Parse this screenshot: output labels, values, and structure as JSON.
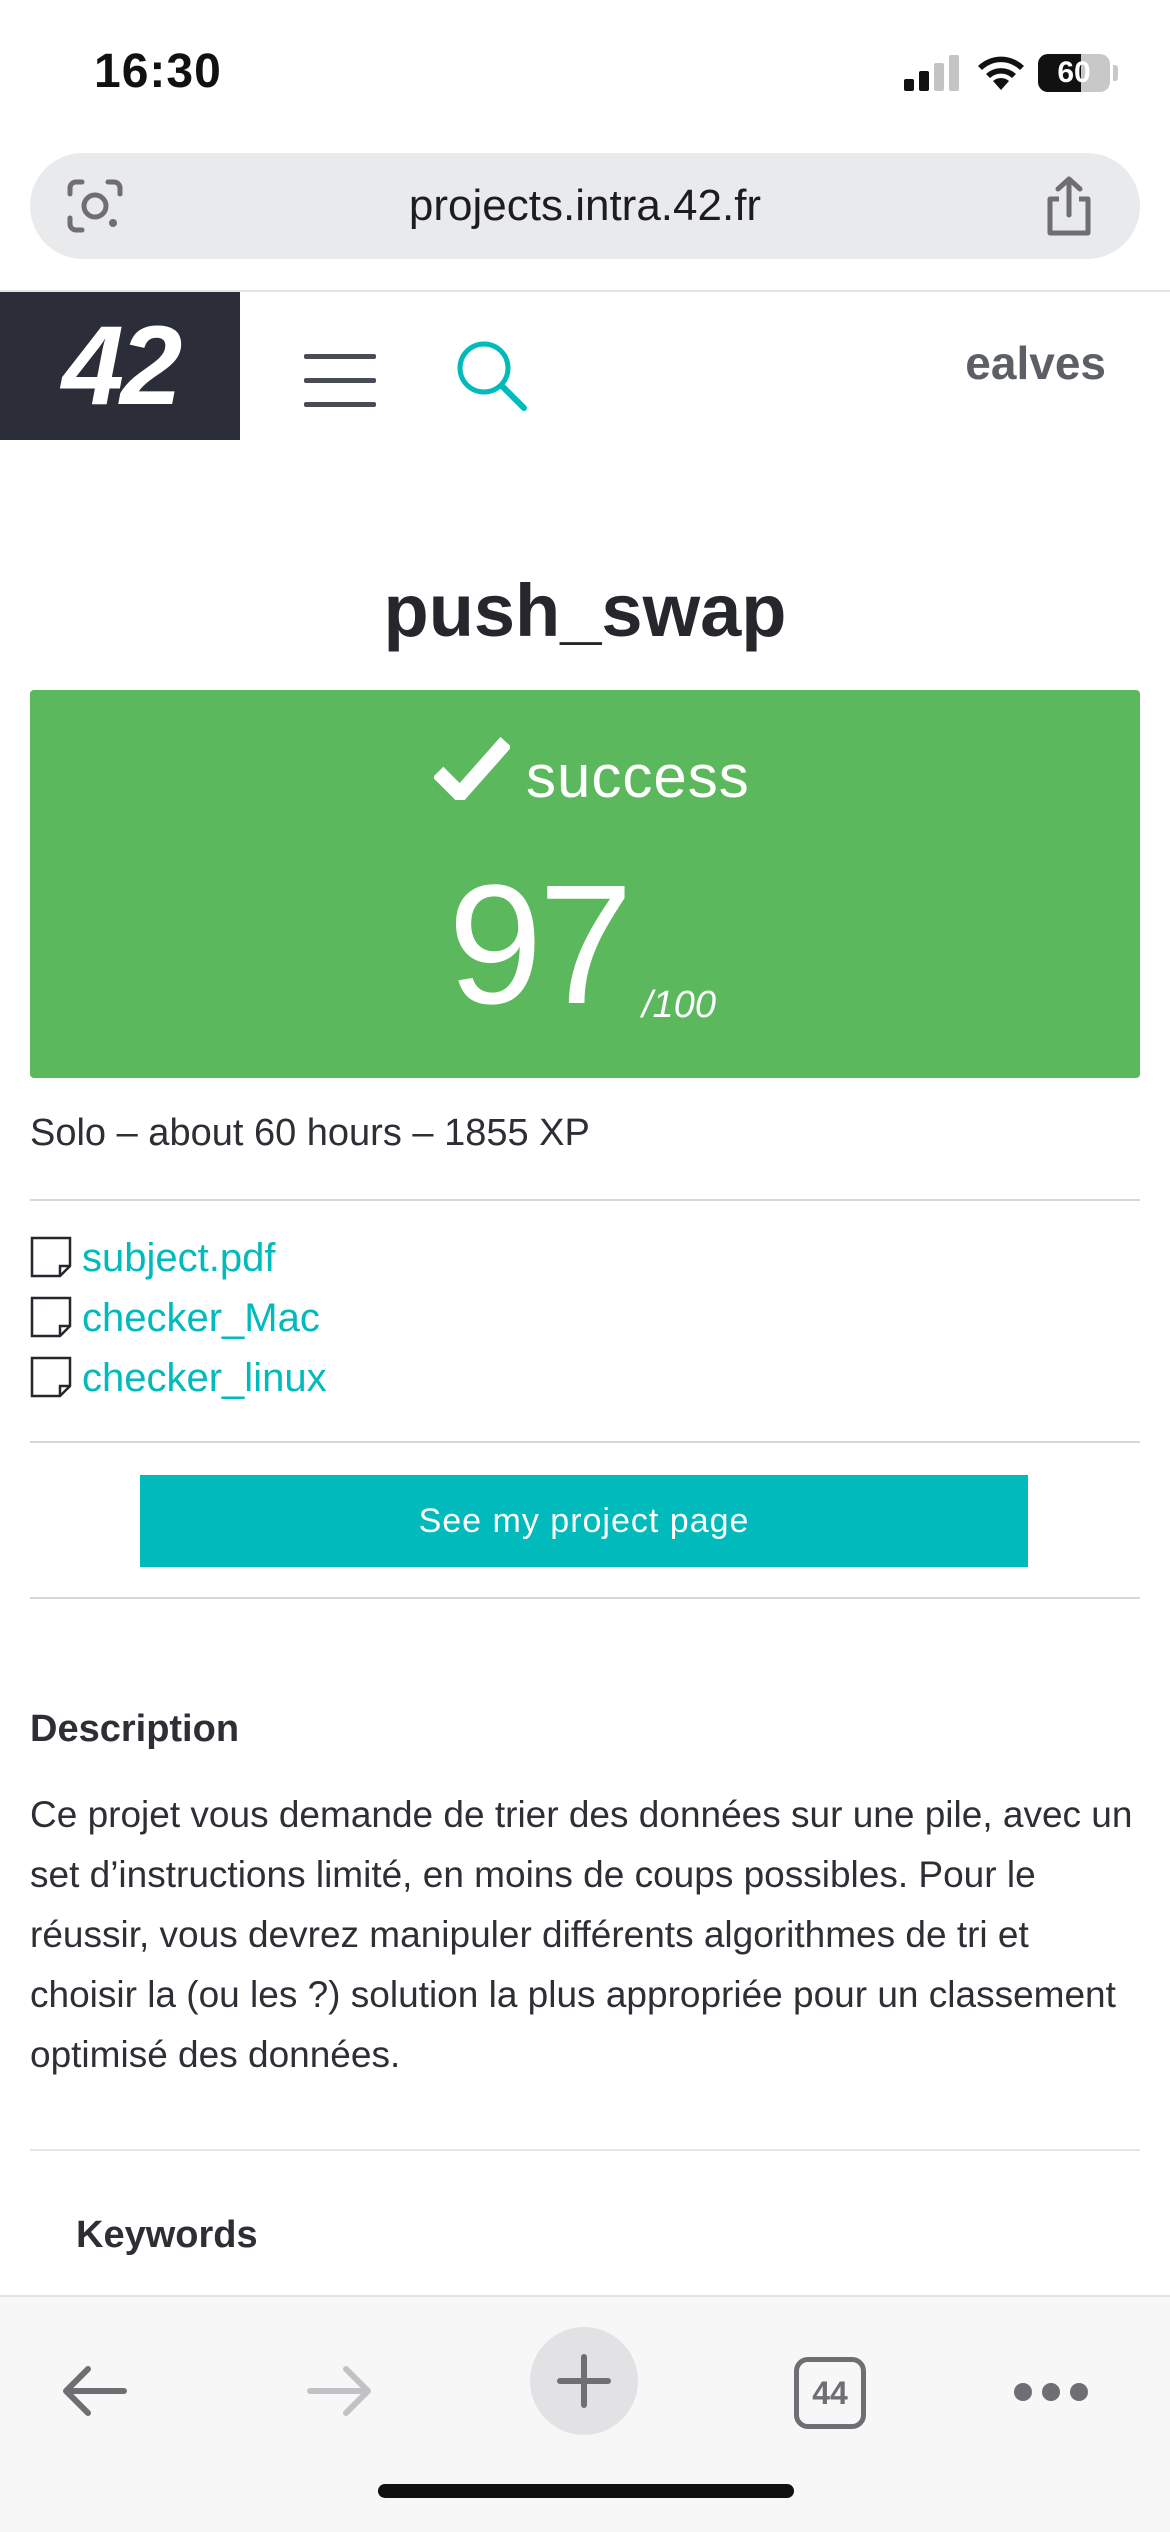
{
  "status_bar": {
    "time": "16:30",
    "battery": "60",
    "battery_level": 0.6
  },
  "browser": {
    "url": "projects.intra.42.fr",
    "left_icon": "lens-icon",
    "right_icon": "share-icon"
  },
  "header": {
    "logo": "42",
    "menu_icon": "hamburger-menu-icon",
    "search_icon": "search-icon",
    "username": "ealves"
  },
  "project": {
    "title": "push_swap",
    "status": "success",
    "score": "97",
    "score_max": "/100",
    "meta": "Solo – about 60 hours – 1855 XP",
    "files": [
      {
        "name": "subject.pdf",
        "icon": "file-icon"
      },
      {
        "name": "checker_Mac",
        "icon": "file-icon"
      },
      {
        "name": "checker_linux",
        "icon": "file-icon"
      }
    ],
    "button_label": "See my project page",
    "description_title": "Description",
    "description": "Ce projet vous demande de trier des données sur une pile, avec un set d’instructions limité, en moins de coups possibles. Pour le réussir, vous devrez manipuler différents algorithmes de tri et choisir la (ou les ?) solution la plus appropriée pour un classement optimisé des données.",
    "keywords_title": "Keywords"
  },
  "toolbar": {
    "tabs_count": "44",
    "icons": [
      "back-arrow-icon",
      "forward-arrow-icon",
      "plus-icon",
      "tabs-icon",
      "more-icon"
    ]
  },
  "colors": {
    "success": "#5cb85c",
    "accent": "#00babc",
    "logo_bg": "#2b2e38"
  }
}
